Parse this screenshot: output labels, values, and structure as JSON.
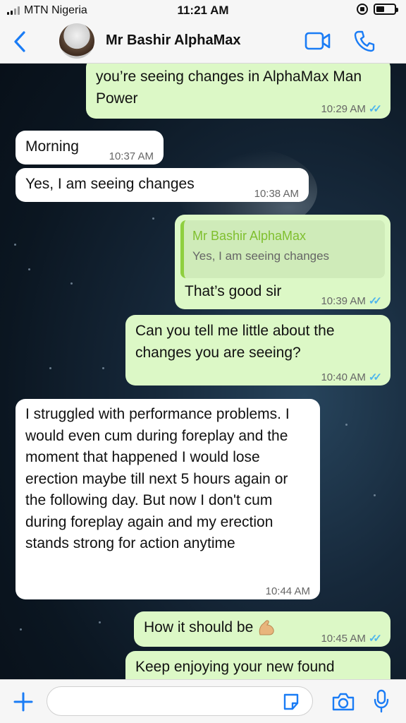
{
  "status_bar": {
    "carrier": "MTN Nigeria",
    "time": "11:21 AM"
  },
  "header": {
    "contact_name": "Mr Bashir AlphaMax"
  },
  "messages": [
    {
      "direction": "out",
      "text": "you’re seeing changes in AlphaMax Man Power",
      "time": "10:29 AM"
    },
    {
      "direction": "in",
      "text": "Morning",
      "time": "10:37 AM"
    },
    {
      "direction": "in",
      "text": "Yes, I am seeing changes",
      "time": "10:38 AM"
    },
    {
      "direction": "out",
      "quote_author": "Mr Bashir AlphaMax",
      "quote_text": "Yes, I am seeing changes",
      "text": "That’s good sir",
      "time": "10:39 AM"
    },
    {
      "direction": "out",
      "text": "Can you tell me little about the changes you are seeing?",
      "time": "10:40 AM"
    },
    {
      "direction": "in",
      "text": "I struggled with performance problems. I would even cum during foreplay and the moment that happened I would lose erection maybe till next 5 hours again or the following day. But now I don't cum during foreplay again and my erection stands strong for action anytime",
      "time": "10:44 AM"
    },
    {
      "direction": "out",
      "text": "How it should be",
      "emoji": "flexed-biceps",
      "time": "10:45 AM"
    },
    {
      "direction": "out",
      "text": "Keep enjoying your new found",
      "time": ""
    }
  ],
  "input": {
    "placeholder": ""
  },
  "colors": {
    "outgoing_bubble": "#dcf8c6",
    "incoming_bubble": "#ffffff",
    "ios_blue": "#1a7cf5",
    "read_ticks": "#4fb6ec",
    "quote_accent": "#8fcf3f"
  }
}
